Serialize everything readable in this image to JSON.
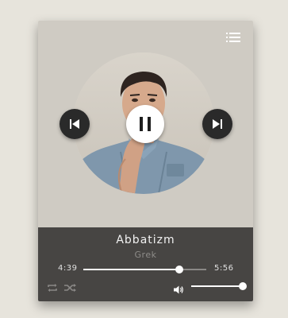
{
  "track": {
    "title": "Abbatizm",
    "artist": "Grek"
  },
  "progress": {
    "elapsed": "4:39",
    "total": "5:56",
    "fraction": 0.78
  },
  "volume": {
    "fraction": 0.97
  },
  "icons": {
    "playlist": "list-icon",
    "previous": "skip-previous-icon",
    "next": "skip-next-icon",
    "pause": "pause-icon",
    "repeat": "repeat-icon",
    "shuffle": "shuffle-icon",
    "volume": "volume-icon"
  },
  "colors": {
    "top_panel": "#cfcbc3",
    "bottom_panel": "#474543",
    "accent": "#ffffff",
    "button_dark": "#2a2a2a"
  }
}
